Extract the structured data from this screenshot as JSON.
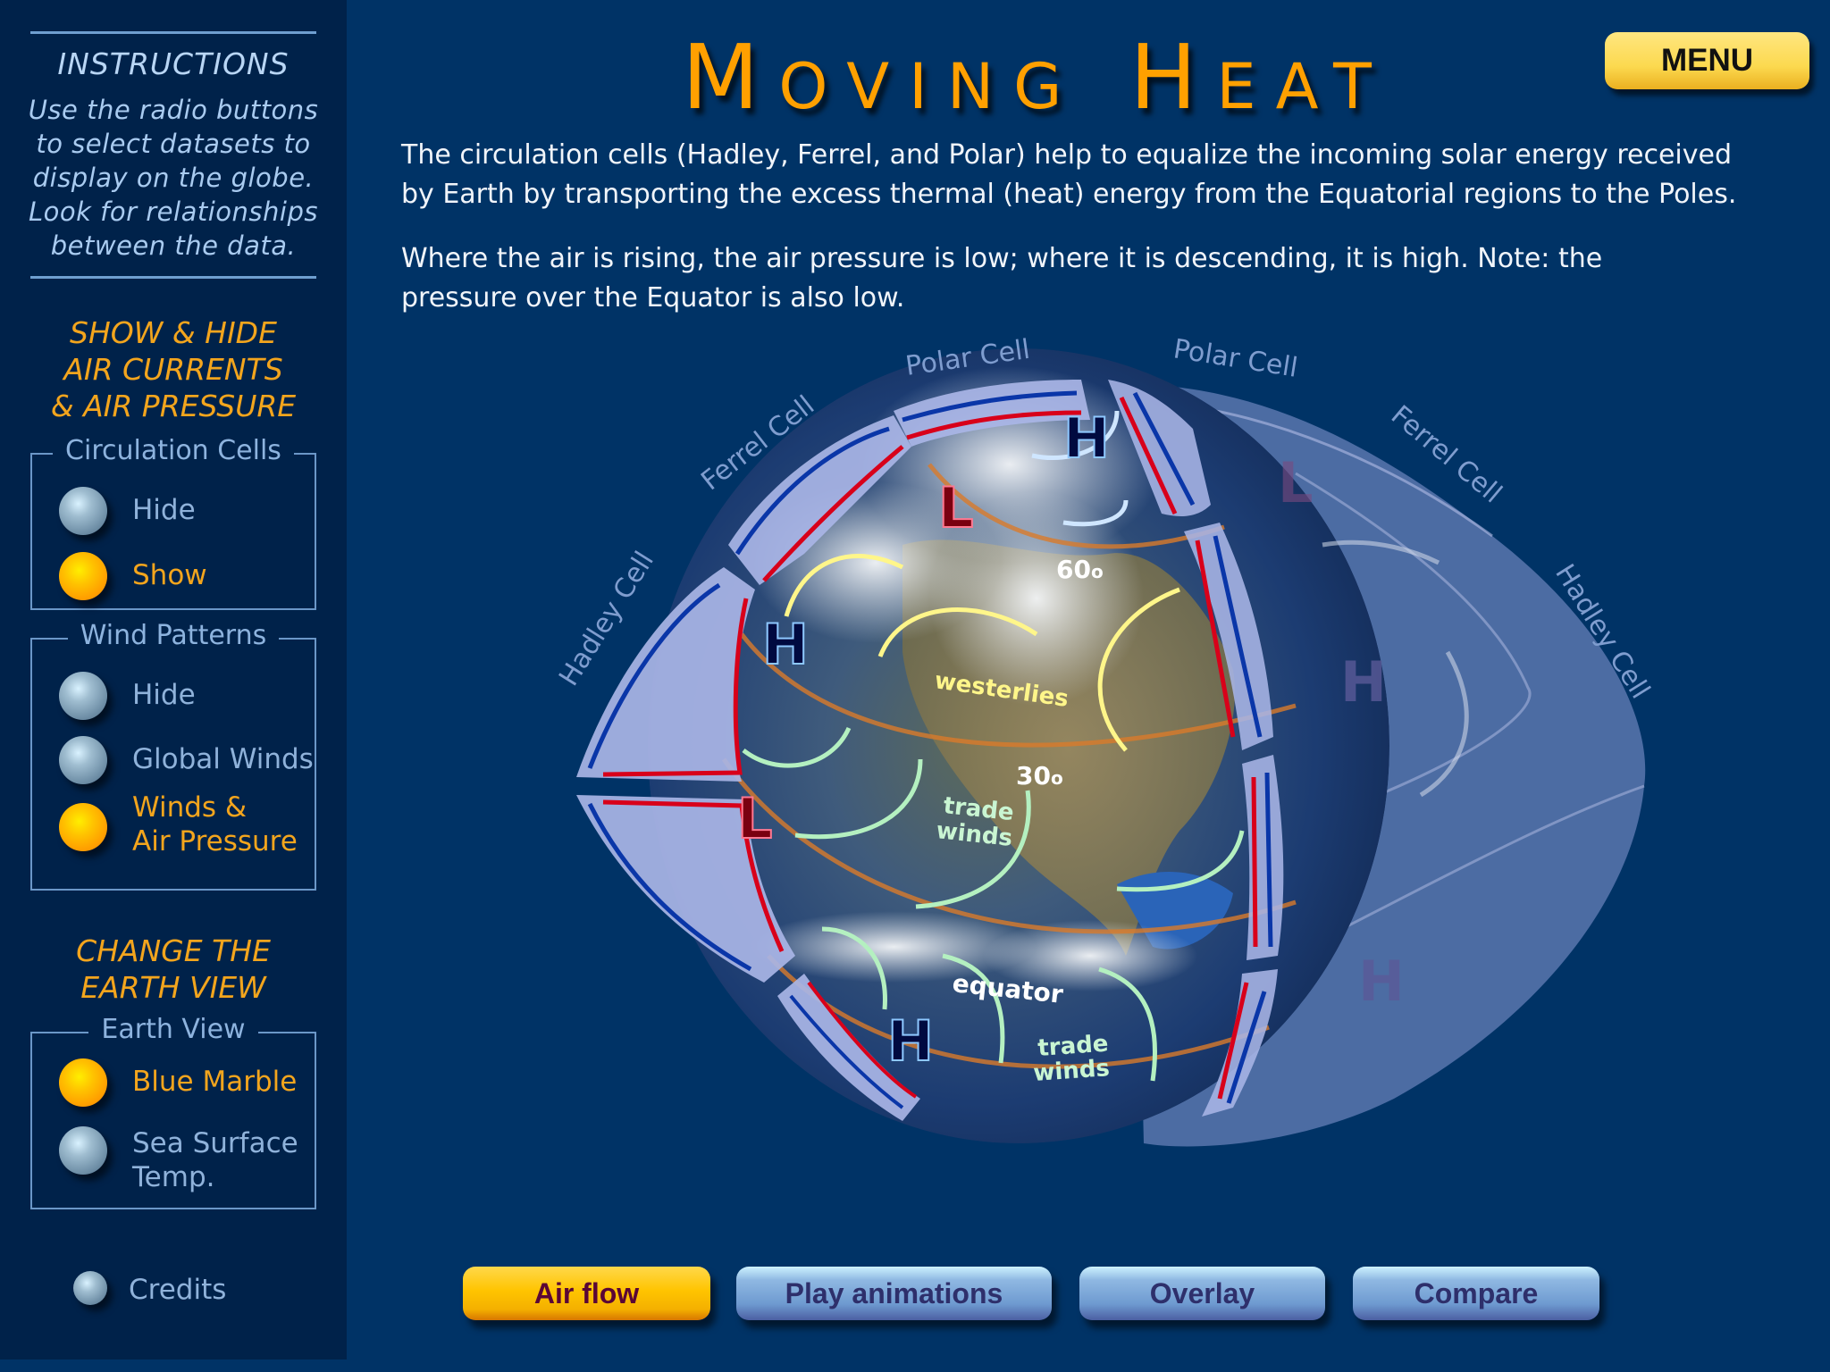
{
  "title": "Moving Heat",
  "menu_label": "MENU",
  "sidebar": {
    "instructions_title": "INSTRUCTIONS",
    "instructions_lines": [
      "Use the radio buttons",
      "to select datasets to",
      "display on the globe.",
      "Look for relationships",
      "between the data."
    ],
    "section1_lines": [
      "SHOW & HIDE",
      "AIR CURRENTS",
      "& AIR PRESSURE"
    ],
    "circulation_cells": {
      "legend": "Circulation Cells",
      "options": [
        {
          "label": "Hide",
          "selected": false
        },
        {
          "label": "Show",
          "selected": true
        }
      ]
    },
    "wind_patterns": {
      "legend": "Wind Patterns",
      "options": [
        {
          "label": "Hide",
          "selected": false
        },
        {
          "label": "Global Winds",
          "selected": false
        },
        {
          "label_lines": [
            "Winds &",
            "Air Pressure"
          ],
          "selected": true
        }
      ]
    },
    "section2_lines": [
      "CHANGE THE",
      "EARTH VIEW"
    ],
    "earth_view": {
      "legend": "Earth View",
      "options": [
        {
          "label": "Blue Marble",
          "selected": true
        },
        {
          "label_lines": [
            "Sea Surface",
            "Temp."
          ],
          "selected": false
        }
      ]
    },
    "credits_label": "Credits"
  },
  "intro": {
    "p1_lines": [
      "The circulation cells (Hadley, Ferrel, and Polar) help to equalize the incoming solar energy received",
      "by Earth by transporting the excess thermal (heat) energy from the Equatorial regions to the Poles."
    ],
    "p2_lines": [
      "Where the air is rising, the air pressure is low; where it is descending, it is high. Note: the",
      "pressure over the Equator is also low."
    ]
  },
  "diagram": {
    "cell_labels_left": {
      "polar": "Polar Cell",
      "ferrel": "Ferrel Cell",
      "hadley": "Hadley Cell"
    },
    "cell_labels_right": {
      "polar": "Polar Cell",
      "ferrel": "Ferrel Cell",
      "hadley": "Hadley Cell"
    },
    "latitudes": {
      "lat60": "60",
      "lat30": "30",
      "equator": "equator"
    },
    "degree_symbol": "o",
    "wind_labels": {
      "westerlies": "westerlies",
      "trade_winds_1": [
        "trade",
        "winds"
      ],
      "trade_winds_2": [
        "trade",
        "winds"
      ]
    },
    "pressure_labels": {
      "high": "H",
      "low": "L"
    },
    "colors": {
      "warm_flow": "#d8001a",
      "cool_flow": "#0a36a8",
      "westerlies_arrow": "#fff68a",
      "trade_arrow": "#b4f0c0",
      "polar_arrow": "#cfe6ff",
      "latitude_line": "#d97a2a"
    }
  },
  "bottom_buttons": [
    {
      "label": "Air flow",
      "active": true
    },
    {
      "label": "Play animations",
      "active": false
    },
    {
      "label": "Overlay",
      "active": false
    },
    {
      "label": "Compare",
      "active": false
    }
  ]
}
